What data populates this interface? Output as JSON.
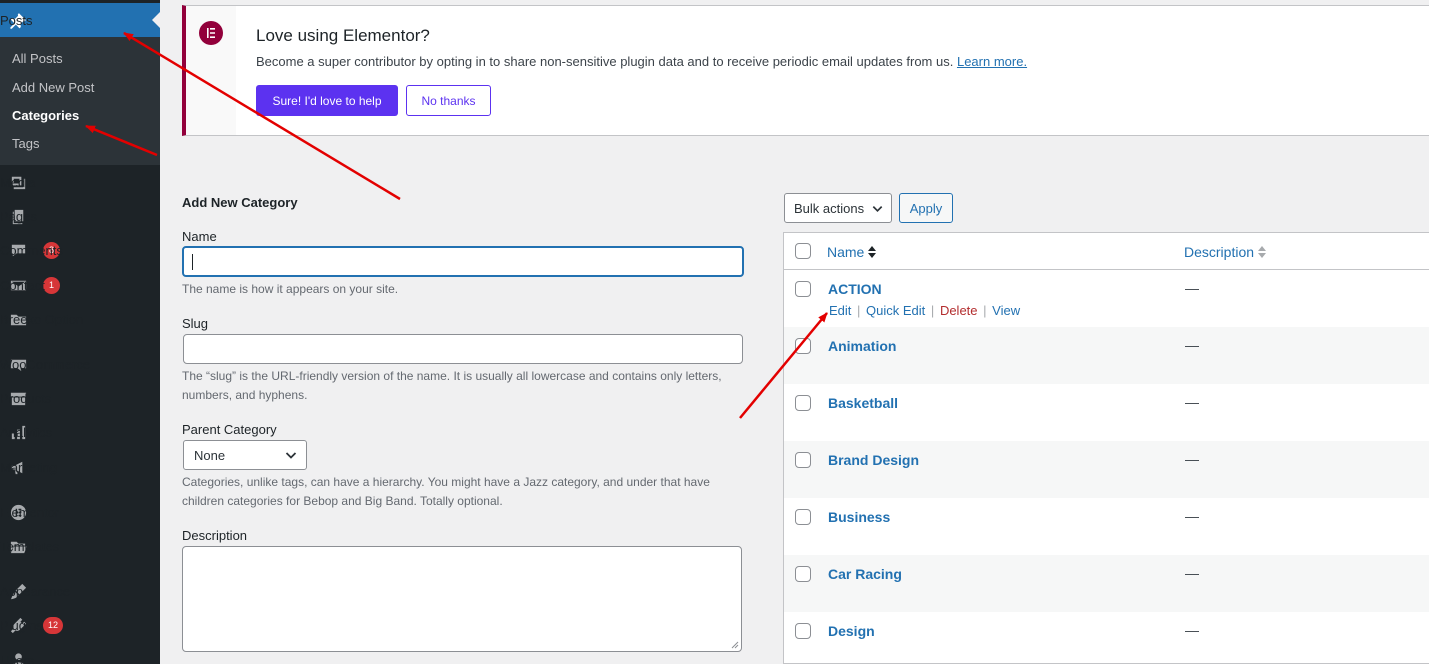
{
  "sidebar": {
    "posts": "Posts",
    "submenu": [
      "All Posts",
      "Add New Post",
      "Categories",
      "Tags"
    ],
    "items": [
      {
        "label": "Media",
        "icon": "media-icon"
      },
      {
        "label": "Pages",
        "icon": "pages-icon"
      },
      {
        "label": "Comments",
        "icon": "comments-icon",
        "count": "8"
      },
      {
        "label": "Contact",
        "icon": "mail-icon",
        "count": "1"
      },
      {
        "label": "Breeko Option",
        "icon": "folder-icon"
      },
      {
        "label": "WooCommerce",
        "icon": "woocommerce-icon"
      },
      {
        "label": "Products",
        "icon": "archive-icon"
      },
      {
        "label": "Analytics",
        "icon": "bar-chart-icon"
      },
      {
        "label": "Marketing",
        "icon": "megaphone-icon"
      },
      {
        "label": "Elementor",
        "icon": "elementor-icon"
      },
      {
        "label": "Templates",
        "icon": "folder-open-icon"
      },
      {
        "label": "Appearance",
        "icon": "paintbrush-icon"
      },
      {
        "label": "Plugins",
        "icon": "plugin-icon",
        "count": "12"
      },
      {
        "label": "Users",
        "icon": "users-icon"
      }
    ]
  },
  "notice": {
    "title": "Love using Elementor?",
    "description": "Become a super contributor by opting in to share non-sensitive plugin data and to receive periodic email updates from us.",
    "link": "Learn more.",
    "primary_button": "Sure! I'd love to help",
    "secondary_button": "No thanks"
  },
  "form": {
    "heading": "Add New Category",
    "name_label": "Name",
    "name_value": "",
    "name_help": "The name is how it appears on your site.",
    "slug_label": "Slug",
    "slug_value": "",
    "slug_help": "The “slug” is the URL-friendly version of the name. It is usually all lowercase and contains only letters, numbers, and hyphens.",
    "parent_label": "Parent Category",
    "parent_value": "None",
    "parent_help": "Categories, unlike tags, can have a hierarchy. You might have a Jazz category, and under that have children categories for Bebop and Big Band. Totally optional.",
    "description_label": "Description"
  },
  "table": {
    "bulk_actions": "Bulk actions",
    "apply": "Apply",
    "col_name": "Name",
    "col_description": "Description",
    "row_actions": {
      "edit": "Edit",
      "quick_edit": "Quick Edit",
      "delete": "Delete",
      "view": "View",
      "separator": "|"
    },
    "rows": [
      {
        "name": "ACTION",
        "description": "—"
      },
      {
        "name": "Animation",
        "description": "—"
      },
      {
        "name": "Basketball",
        "description": "—"
      },
      {
        "name": "Brand Design",
        "description": "—"
      },
      {
        "name": "Business",
        "description": "—"
      },
      {
        "name": "Car Racing",
        "description": "—"
      },
      {
        "name": "Design",
        "description": "—"
      }
    ]
  },
  "colors": {
    "admin_menu_bg": "#1d2327",
    "accent": "#2271b1",
    "elementor_brand": "#92003b",
    "elementor_button": "#5c32f0",
    "annotation_arrow": "#e30000"
  }
}
